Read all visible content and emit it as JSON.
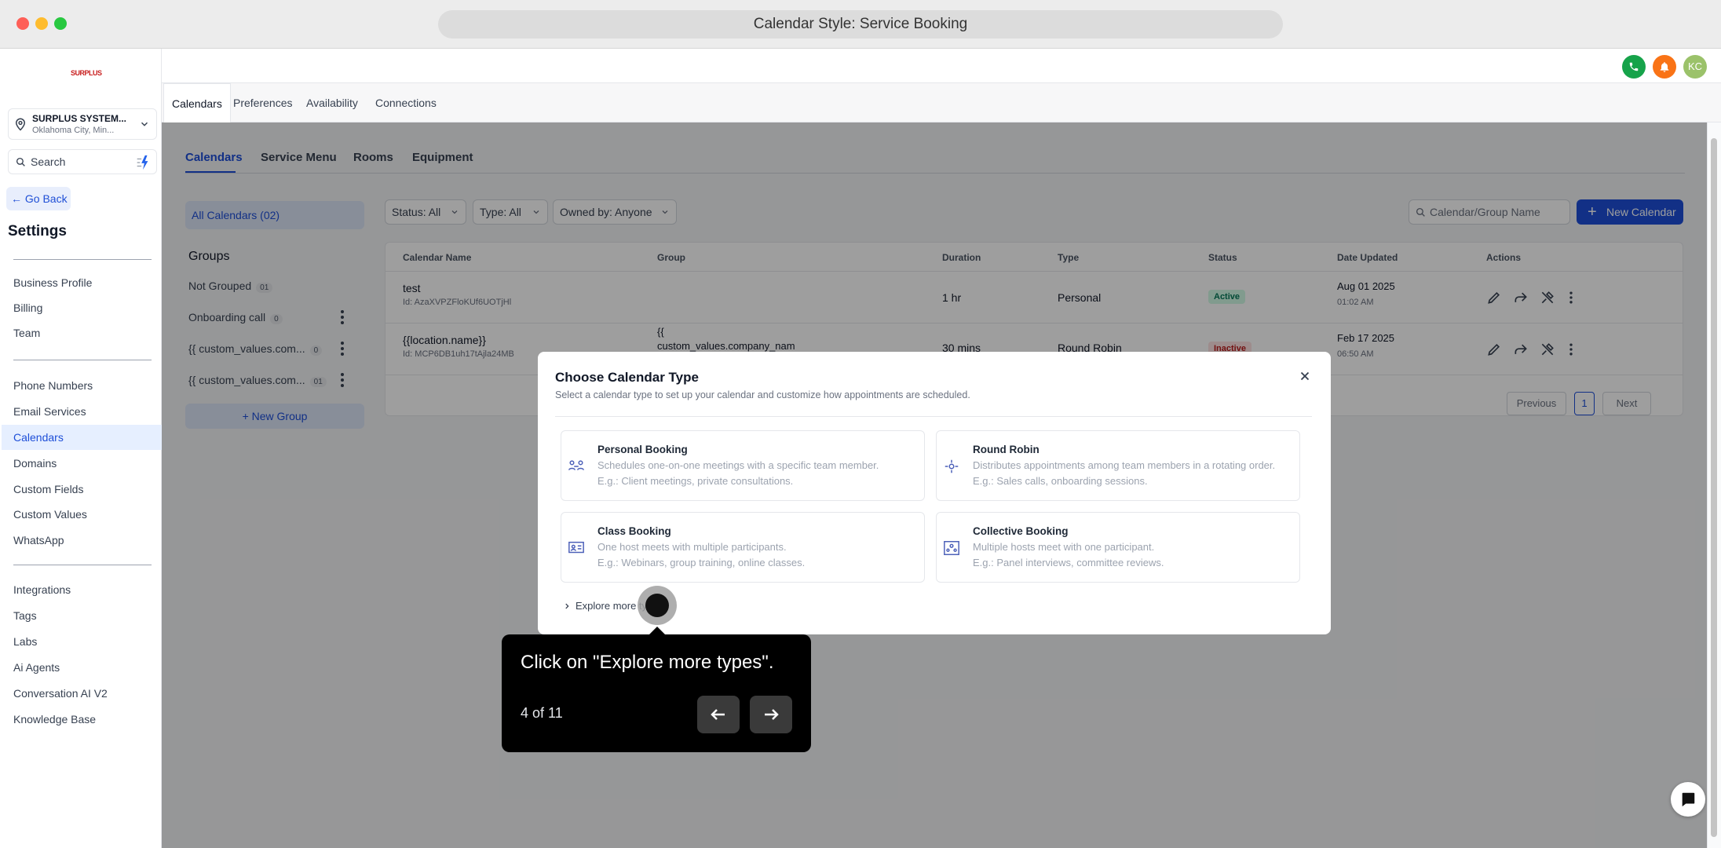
{
  "window": {
    "title": "Calendar Style: Service Booking"
  },
  "sidebar": {
    "logo_text": "SURPLUS",
    "location_name": "SURPLUS SYSTEM...",
    "location_sub": "Oklahoma City, Min...",
    "search_placeholder": "Search",
    "go_back": "Go Back",
    "settings_title": "Settings",
    "items": [
      {
        "label": "Business Profile"
      },
      {
        "label": "Billing"
      },
      {
        "label": "Team"
      },
      {
        "label": "Phone Numbers"
      },
      {
        "label": "Email Services"
      },
      {
        "label": "Calendars"
      },
      {
        "label": "Domains"
      },
      {
        "label": "Custom Fields"
      },
      {
        "label": "Custom Values"
      },
      {
        "label": "WhatsApp"
      },
      {
        "label": "Integrations"
      },
      {
        "label": "Tags"
      },
      {
        "label": "Labs"
      },
      {
        "label": "Ai Agents"
      },
      {
        "label": "Conversation AI V2"
      },
      {
        "label": "Knowledge Base"
      }
    ]
  },
  "header": {
    "avatar_initials": "KC",
    "colors": {
      "phone": "#16a34a",
      "bell": "#f97316",
      "avatar": "#9bc26a"
    }
  },
  "top_tabs": [
    "Calendars",
    "Preferences",
    "Availability",
    "Connections"
  ],
  "sub_tabs": [
    "Calendars",
    "Service Menu",
    "Rooms",
    "Equipment"
  ],
  "calendars_panel": {
    "all_calendars": "All Calendars (02)",
    "groups_title": "Groups",
    "groups": [
      {
        "name": "Not Grouped",
        "count": "01"
      },
      {
        "name": "Onboarding call",
        "count": "0"
      },
      {
        "name": "{{ custom_values.com...",
        "count": "0"
      },
      {
        "name": "{{ custom_values.com...",
        "count": "01"
      }
    ],
    "new_group": "+ New Group"
  },
  "filters": {
    "status": "Status: All",
    "type": "Type: All",
    "owned_by": "Owned by: Anyone",
    "search_placeholder": "Calendar/Group Name",
    "new_calendar": "New Calendar"
  },
  "table": {
    "headers": [
      "Calendar Name",
      "Group",
      "Duration",
      "Type",
      "Status",
      "Date Updated",
      "Actions"
    ],
    "rows": [
      {
        "name": "test",
        "id": "Id: AzaXVPZFloKUf6UOTjHl",
        "group": "",
        "duration": "1 hr",
        "type": "Personal",
        "status": "Active",
        "date": "Aug 01 2025",
        "time": "01:02 AM"
      },
      {
        "name": "{{location.name}}",
        "id": "Id: MCP6DB1uh17tAjla24MB",
        "group_line1": "{{",
        "group_line2": "custom_values.company_nam",
        "duration": "30 mins",
        "type": "Round Robin",
        "status": "Inactive",
        "date": "Feb 17 2025",
        "time": "06:50 AM"
      }
    ],
    "pager": {
      "previous": "Previous",
      "page": "1",
      "next": "Next"
    }
  },
  "modal": {
    "title": "Choose Calendar Type",
    "subtitle": "Select a calendar type to set up your calendar and customize how appointments are scheduled.",
    "cards": [
      {
        "title": "Personal Booking",
        "desc": "Schedules one-on-one meetings with a specific team member.",
        "example": "E.g.: Client meetings, private consultations."
      },
      {
        "title": "Round Robin",
        "desc": "Distributes appointments among team members in a rotating order.",
        "example": "E.g.: Sales calls, onboarding sessions."
      },
      {
        "title": "Class Booking",
        "desc": "One host meets with multiple participants.",
        "example": "E.g.: Webinars, group training, online classes."
      },
      {
        "title": "Collective Booking",
        "desc": "Multiple hosts meet with one participant.",
        "example": "E.g.: Panel interviews, committee reviews."
      }
    ],
    "explore": "Explore more ty"
  },
  "tooltip": {
    "text": "Click on \"Explore more types\".",
    "step": "4 of 11"
  }
}
